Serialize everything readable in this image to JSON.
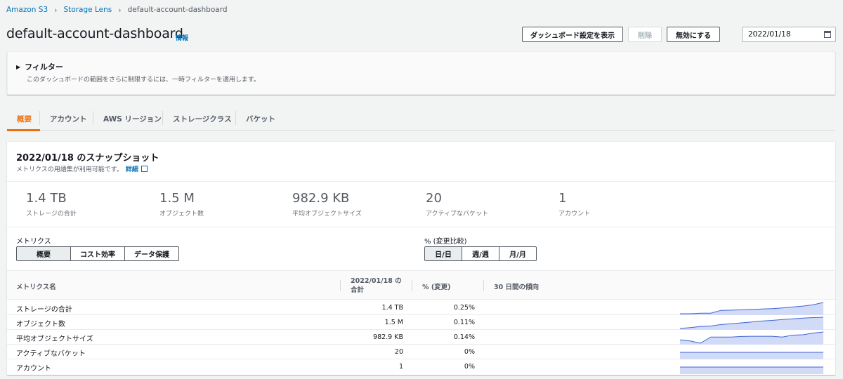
{
  "breadcrumb": {
    "items": [
      "Amazon S3",
      "Storage Lens",
      "default-account-dashboard"
    ]
  },
  "header": {
    "title": "default-account-dashboard",
    "info_label": "情報",
    "buttons": {
      "view_settings": "ダッシュボード設定を表示",
      "delete": "削除",
      "disable": "無効にする"
    },
    "date_value": "2022/01/18"
  },
  "filter": {
    "title": "フィルター",
    "description": "このダッシュボードの範囲をさらに制限するには、一時フィルターを適用します。"
  },
  "tabs": [
    {
      "label": "概要",
      "active": true
    },
    {
      "label": "アカウント",
      "active": false
    },
    {
      "label": "AWS リージョン",
      "active": false
    },
    {
      "label": "ストレージクラス",
      "active": false
    },
    {
      "label": "バケット",
      "active": false
    }
  ],
  "snapshot": {
    "title": "2022/01/18 のスナップショット",
    "description": "メトリクスの用語集が利用可能です。",
    "link_label": "詳細",
    "stats": [
      {
        "value": "1.4 TB",
        "label": "ストレージの合計"
      },
      {
        "value": "1.5 M",
        "label": "オブジェクト数"
      },
      {
        "value": "982.9 KB",
        "label": "平均オブジェクトサイズ"
      },
      {
        "value": "20",
        "label": "アクティブなバケット"
      },
      {
        "value": "1",
        "label": "アカウント"
      }
    ]
  },
  "metrics_selector": {
    "label": "メトリクス",
    "options": [
      "概要",
      "コスト効率",
      "データ保護"
    ],
    "selected": "概要"
  },
  "compare_selector": {
    "label": "% (変更比較)",
    "options": [
      "日/日",
      "週/週",
      "月/月"
    ],
    "selected": "日/日"
  },
  "table": {
    "headers": {
      "metric": "メトリクス名",
      "total_line1": "2022/01/18 の",
      "total_line2": "合計",
      "pct": "% (変更)",
      "trend": "30 日間の傾向"
    },
    "rows": [
      {
        "name": "ストレージの合計",
        "total": "1.4 TB",
        "pct": "0.25%",
        "trend": [
          0.0,
          0.0,
          0.05,
          0.05,
          0.3,
          0.32,
          0.35,
          0.38,
          0.42,
          0.45,
          0.52,
          0.6,
          0.68,
          0.8,
          1.0
        ]
      },
      {
        "name": "オブジェクト数",
        "total": "1.5 M",
        "pct": "0.11%",
        "trend": [
          0.0,
          0.08,
          0.18,
          0.22,
          0.35,
          0.42,
          0.5,
          0.58,
          0.66,
          0.72,
          0.8,
          0.86,
          0.92,
          0.97,
          1.0
        ]
      },
      {
        "name": "平均オブジェクトサイズ",
        "total": "982.9 KB",
        "pct": "0.14%",
        "trend": [
          0.3,
          0.2,
          0.0,
          0.55,
          0.55,
          0.55,
          0.6,
          0.62,
          0.62,
          0.62,
          0.55,
          0.72,
          0.75,
          0.9,
          1.0
        ]
      },
      {
        "name": "アクティブなバケット",
        "total": "20",
        "pct": "0%",
        "trend": [
          0.5,
          0.5,
          0.5,
          0.5,
          0.5,
          0.5,
          0.5,
          0.5,
          0.5,
          0.5,
          0.5,
          0.5,
          0.5,
          0.5,
          0.5
        ]
      },
      {
        "name": "アカウント",
        "total": "1",
        "pct": "0%",
        "trend": [
          0.5,
          0.5,
          0.5,
          0.5,
          0.5,
          0.5,
          0.5,
          0.5,
          0.5,
          0.5,
          0.5,
          0.5,
          0.5,
          0.5,
          0.5
        ]
      }
    ]
  },
  "colors": {
    "accent": "#ec7211",
    "link": "#0073bb",
    "trend_fill": "#d1daf7",
    "trend_line": "#3f64d6"
  }
}
